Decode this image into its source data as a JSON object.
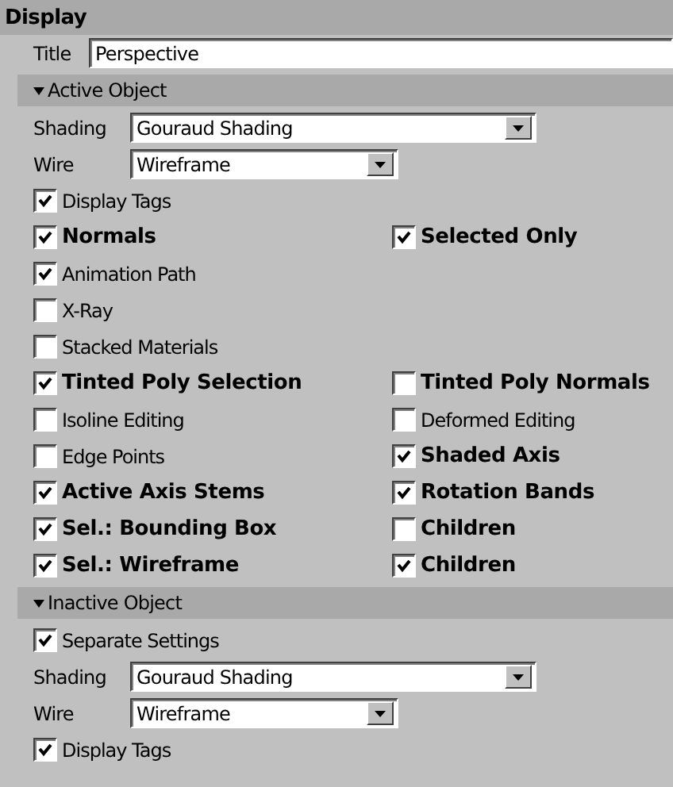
{
  "header": {
    "title": "Display"
  },
  "title_field": {
    "label": "Title",
    "value": "Perspective"
  },
  "sections": [
    {
      "title": "Active Object",
      "expanded": true,
      "rows": [
        {
          "kind": "dropdown",
          "label": "Shading",
          "value": "Gouraud Shading",
          "wide": true
        },
        {
          "kind": "dropdown",
          "label": "Wire",
          "value": "Wireframe",
          "wide": false
        },
        {
          "kind": "checks",
          "items": [
            {
              "label": "Display Tags",
              "checked": true,
              "bold": false
            }
          ]
        },
        {
          "kind": "checks",
          "items": [
            {
              "label": "Normals",
              "checked": true,
              "bold": true
            },
            {
              "label": "Selected Only",
              "checked": true,
              "bold": true
            }
          ]
        },
        {
          "kind": "checks",
          "items": [
            {
              "label": "Animation Path",
              "checked": true,
              "bold": false
            }
          ]
        },
        {
          "kind": "checks",
          "items": [
            {
              "label": "X-Ray",
              "checked": false,
              "bold": false
            }
          ]
        },
        {
          "kind": "checks",
          "items": [
            {
              "label": "Stacked Materials",
              "checked": false,
              "bold": false
            }
          ]
        },
        {
          "kind": "checks",
          "items": [
            {
              "label": "Tinted Poly Selection",
              "checked": true,
              "bold": true
            },
            {
              "label": "Tinted Poly Normals",
              "checked": false,
              "bold": true
            }
          ]
        },
        {
          "kind": "checks",
          "items": [
            {
              "label": "Isoline Editing",
              "checked": false,
              "bold": false
            },
            {
              "label": "Deformed Editing",
              "checked": false,
              "bold": false
            }
          ]
        },
        {
          "kind": "checks",
          "items": [
            {
              "label": "Edge Points",
              "checked": false,
              "bold": false
            },
            {
              "label": "Shaded Axis",
              "checked": true,
              "bold": true
            }
          ]
        },
        {
          "kind": "checks",
          "items": [
            {
              "label": "Active Axis Stems",
              "checked": true,
              "bold": true
            },
            {
              "label": "Rotation Bands",
              "checked": true,
              "bold": true
            }
          ]
        },
        {
          "kind": "checks",
          "items": [
            {
              "label": "Sel.: Bounding Box",
              "checked": true,
              "bold": true
            },
            {
              "label": "Children",
              "checked": false,
              "bold": true
            }
          ]
        },
        {
          "kind": "checks",
          "items": [
            {
              "label": "Sel.: Wireframe",
              "checked": true,
              "bold": true
            },
            {
              "label": "Children",
              "checked": true,
              "bold": true
            }
          ]
        }
      ]
    },
    {
      "title": "Inactive Object",
      "expanded": true,
      "rows": [
        {
          "kind": "checks",
          "items": [
            {
              "label": "Separate Settings",
              "checked": true,
              "bold": false
            }
          ]
        },
        {
          "kind": "dropdown",
          "label": "Shading",
          "value": "Gouraud Shading",
          "wide": true
        },
        {
          "kind": "dropdown",
          "label": "Wire",
          "value": "Wireframe",
          "wide": false
        },
        {
          "kind": "checks",
          "items": [
            {
              "label": "Display Tags",
              "checked": true,
              "bold": false
            }
          ]
        }
      ]
    }
  ]
}
